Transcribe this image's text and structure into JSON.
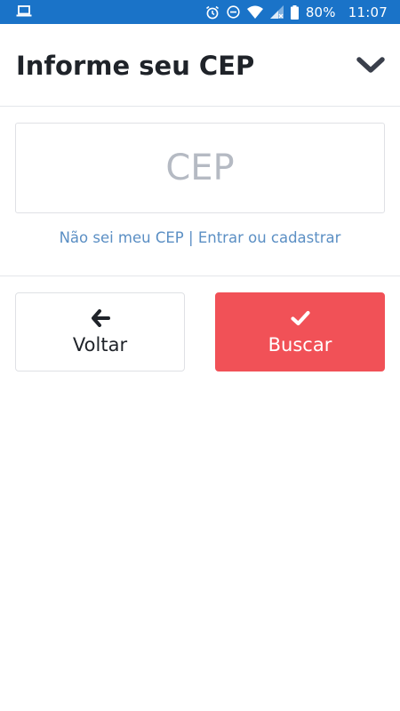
{
  "status_bar": {
    "battery_percent": "80%",
    "time": "11:07",
    "bg_color": "#1a73c8",
    "icons": [
      "laptop-icon",
      "alarm-icon",
      "do-not-disturb-icon",
      "wifi-icon",
      "signal-icon",
      "battery-icon"
    ]
  },
  "header": {
    "title": "Informe seu CEP",
    "toggle_icon": "chevron-down-icon"
  },
  "cep_field": {
    "placeholder": "CEP",
    "value": ""
  },
  "links": {
    "dont_know_cep": "Não sei meu CEP",
    "separator": "|",
    "login_register": "Entrar ou cadastrar",
    "color": "#5b8fc4"
  },
  "actions": {
    "back": {
      "label": "Voltar",
      "icon": "arrow-left-icon"
    },
    "search": {
      "label": "Buscar",
      "icon": "check-icon",
      "color": "#f15157"
    }
  }
}
